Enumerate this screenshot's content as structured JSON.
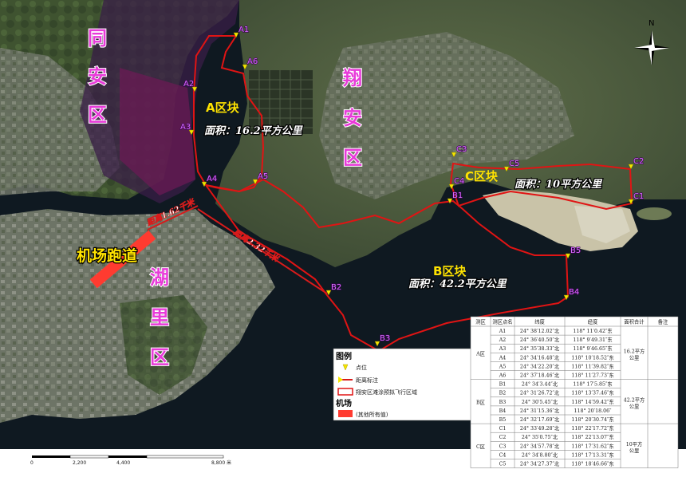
{
  "compass": {
    "label": "N"
  },
  "districts": {
    "tongan": "同安区",
    "xiangan": "翔安区",
    "huli": "湖里区"
  },
  "blocks": {
    "a": {
      "title": "A区块",
      "area": "面积：16.2平方公里"
    },
    "b": {
      "title": "B区块",
      "area": "面积：42.2平方公里"
    },
    "c": {
      "title": "C区块",
      "area": "面积：10平方公里"
    }
  },
  "distances": {
    "d1": "距离1.62千米",
    "d2": "距离2.32千米"
  },
  "runway_label": "机场跑道",
  "points": {
    "A1": "A1",
    "A2": "A2",
    "A3": "A3",
    "A4": "A4",
    "A5": "A5",
    "A6": "A6",
    "B1": "B1",
    "B2": "B2",
    "B3": "B3",
    "B4": "B4",
    "B5": "B5",
    "C1": "C1",
    "C2": "C2",
    "C3": "C3",
    "C4": "C4",
    "C5": "C5"
  },
  "legend": {
    "title": "图例",
    "items": [
      "点位",
      "距离标注",
      "翔安区滩涂预拟飞行区域"
    ],
    "airport_title": "机场",
    "airport_item": "(其他所有值)"
  },
  "table": {
    "headers": [
      "测区",
      "测区点名",
      "纬度",
      "经度",
      "面积合计",
      "备注"
    ],
    "groups": [
      {
        "zone": "A区",
        "area": "16.2平方公里",
        "rows": [
          [
            "A1",
            "24° 38′12.02″北",
            "118° 11′0.42″东"
          ],
          [
            "A2",
            "24° 36′40.50″北",
            "118° 9′49.31″东"
          ],
          [
            "A3",
            "24° 35′38.33″北",
            "118° 9′46.65″东"
          ],
          [
            "A4",
            "24° 34′16.48″北",
            "118° 10′18.52″东"
          ],
          [
            "A5",
            "24° 34′22.20″北",
            "118° 11′39.82″东"
          ],
          [
            "A6",
            "24° 37′18.46″北",
            "118° 11′27.73″东"
          ]
        ]
      },
      {
        "zone": "B区",
        "area": "42.2平方公里",
        "rows": [
          [
            "B1",
            "24° 34′3.44″北",
            "118° 17′5.85″东"
          ],
          [
            "B2",
            "24° 31′26.72″北",
            "118° 13′37.46″东"
          ],
          [
            "B3",
            "24° 30′5.45″北",
            "118° 14′59.42″东"
          ],
          [
            "B4",
            "24° 31′15.36″北",
            "118° 20′18.06″"
          ],
          [
            "B5",
            "24° 32′17.69″北",
            "118° 20′30.74″东"
          ]
        ]
      },
      {
        "zone": "C区",
        "area": "10平方公里",
        "rows": [
          [
            "C1",
            "24° 33′49.28″北",
            "118° 22′17.72″东"
          ],
          [
            "C2",
            "24° 35′0.75″北",
            "118° 22′13.07″东"
          ],
          [
            "C3",
            "24° 34′57.78″北",
            "118° 17′31.62″东"
          ],
          [
            "C4",
            "24° 34′8.80″北",
            "118° 17′13.31″东"
          ],
          [
            "C5",
            "24° 34′27.37″北",
            "118° 18′46.66″东"
          ]
        ]
      }
    ]
  },
  "scale": {
    "ticks": [
      "0",
      "2,200",
      "4,400",
      "8,800"
    ],
    "unit": "米"
  },
  "colors": {
    "boundary": "#e01414",
    "point": "#f5e600",
    "runway": "#ff3b30",
    "district": "#e83ad9",
    "block_title": "#ffe300"
  }
}
